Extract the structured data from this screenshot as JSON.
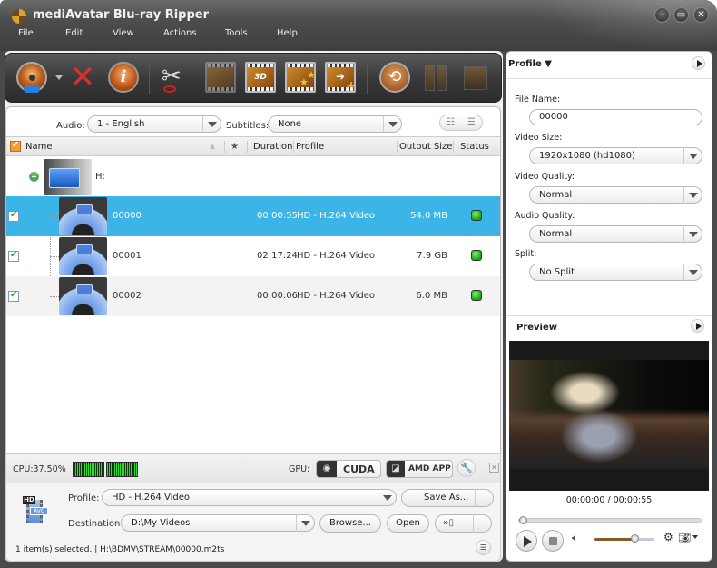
{
  "window": {
    "title": "mediAvatar Blu-ray Ripper",
    "controls": [
      "minimize",
      "maximize",
      "close"
    ]
  },
  "menu": [
    "File",
    "Edit",
    "View",
    "Actions",
    "Tools",
    "Help"
  ],
  "toolbar": {
    "buttons": [
      {
        "name": "add-disc",
        "icon": "disc-icon",
        "has_dropdown": true
      },
      {
        "name": "remove",
        "icon": "x-icon"
      },
      {
        "name": "properties",
        "icon": "info-icon"
      },
      {
        "name": "clip",
        "icon": "scissors-icon"
      },
      {
        "name": "merge",
        "icon": "merge-icon",
        "enabled": false
      },
      {
        "name": "3d",
        "icon": "3d-film-icon",
        "label": "3D"
      },
      {
        "name": "effects",
        "icon": "star-film-icon"
      },
      {
        "name": "add-output",
        "icon": "add-film-icon"
      },
      {
        "name": "convert",
        "icon": "refresh-icon"
      },
      {
        "name": "pause",
        "icon": "pause-icon",
        "enabled": false
      },
      {
        "name": "stop",
        "icon": "stop-icon",
        "enabled": false
      }
    ]
  },
  "filters": {
    "audio_label": "Audio:",
    "audio_value": "1 - English",
    "subtitles_label": "Subtitles:",
    "subtitles_value": "None"
  },
  "columns": {
    "name": "Name",
    "star": "★",
    "duration": "Duration",
    "profile": "Profile",
    "output_size": "Output Size",
    "status": "Status"
  },
  "source": {
    "label": "H:"
  },
  "files": [
    {
      "name": "00000",
      "duration": "00:00:55",
      "profile": "HD - H.264 Video",
      "size": "54.0 MB",
      "checked": true,
      "selected": true
    },
    {
      "name": "00001",
      "duration": "02:17:24",
      "profile": "HD - H.264 Video",
      "size": "7.9 GB",
      "checked": true,
      "selected": false
    },
    {
      "name": "00002",
      "duration": "00:00:06",
      "profile": "HD - H.264 Video",
      "size": "6.0 MB",
      "checked": true,
      "selected": false
    }
  ],
  "status_bar": {
    "cpu": "CPU:37.50%",
    "gpu_label": "GPU:",
    "cuda": "CUDA",
    "amd": "AMD APP"
  },
  "output": {
    "profile_label": "Profile:",
    "profile_value": "HD - H.264 Video",
    "save_as": "Save As...",
    "destination_label": "Destination:",
    "destination_value": "D:\\My Videos",
    "browse": "Browse...",
    "open": "Open",
    "transfer_icon": "»▯"
  },
  "footer": {
    "status": "1 item(s) selected. | H:\\BDMV\\STREAM\\00000.m2ts"
  },
  "profile_panel": {
    "title": "Profile ▼",
    "file_name_label": "File Name:",
    "file_name_value": "00000",
    "video_size_label": "Video Size:",
    "video_size_value": "1920x1080 (hd1080)",
    "video_quality_label": "Video Quality:",
    "video_quality_value": "Normal",
    "audio_quality_label": "Audio Quality:",
    "audio_quality_value": "Normal",
    "split_label": "Split:",
    "split_value": "No Split"
  },
  "preview": {
    "title": "Preview",
    "time": "00:00:00 / 00:00:55",
    "seek_fraction": 0.0,
    "volume_fraction": 0.68
  }
}
